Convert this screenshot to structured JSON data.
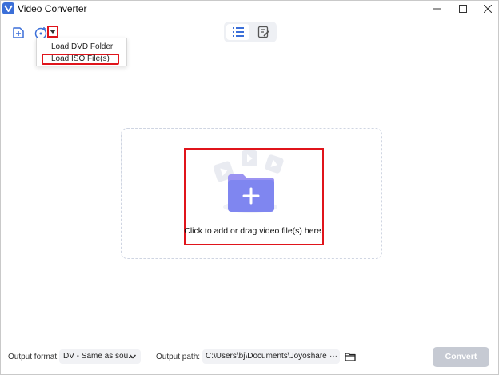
{
  "window": {
    "title": "Video Converter",
    "minimize_glyph": "—",
    "maximize_glyph": "□",
    "close_glyph": "✕"
  },
  "toolbar": {
    "add_file_icon": "add-file-icon",
    "load_dvd_icon": "load-dvd-icon",
    "dropdown_icon": "triangle-down-icon",
    "view_list_icon": "list-view-icon",
    "view_detail_icon": "detail-view-icon"
  },
  "dvd_menu": {
    "items": [
      {
        "label": "Load DVD Folder"
      },
      {
        "label": "Load ISO File(s)"
      }
    ]
  },
  "dropzone": {
    "text": "Click to add or drag video file(s) here.",
    "icon": "add-folder-icon"
  },
  "bottom_bar": {
    "output_format_label": "Output format:",
    "output_format_value": "DV - Same as sou...",
    "output_path_label": "Output path:",
    "output_path_value": "C:\\Users\\bj\\Documents\\Joyoshare VidiK",
    "more_glyph": "···",
    "convert_label": "Convert"
  },
  "colors": {
    "accent": "#3b6fd8",
    "highlight_red": "#e0141b",
    "folder_purple": "#7f7ff2",
    "convert_disabled": "#c6cad3"
  }
}
